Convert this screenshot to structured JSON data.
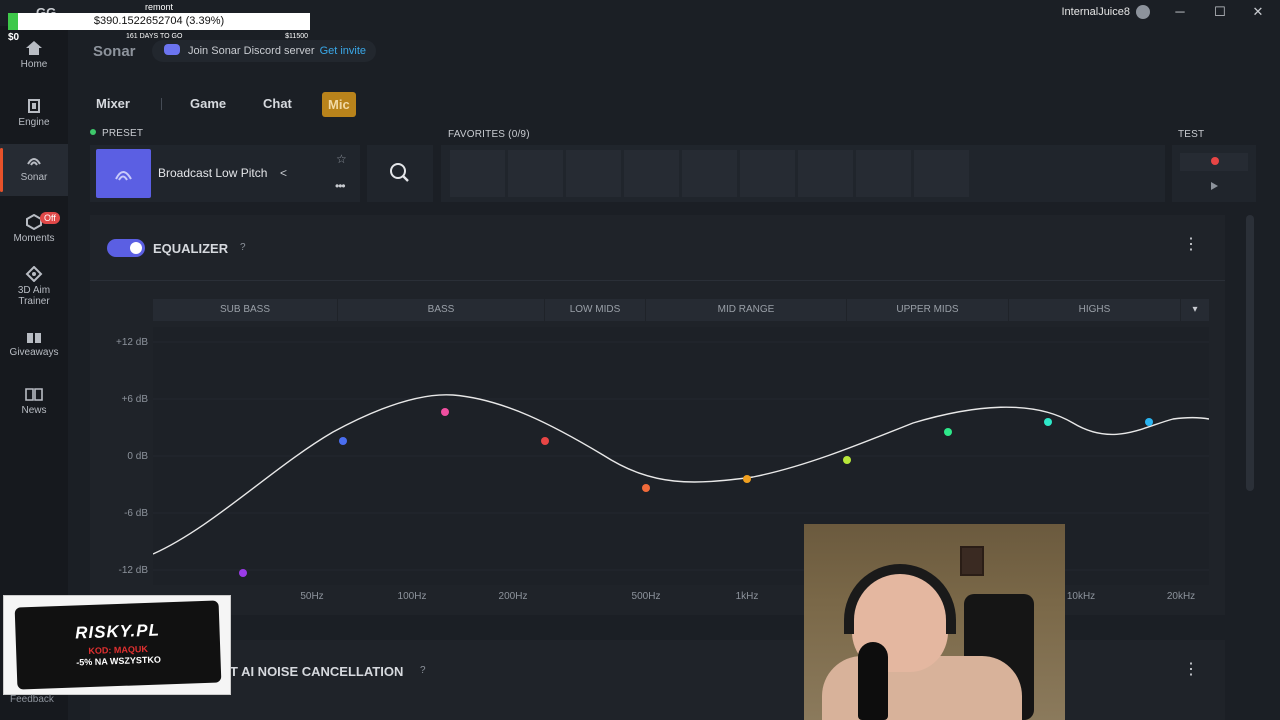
{
  "window": {
    "user": "InternalJuice8",
    "minimize": "─",
    "maximize": "☐",
    "close": "✕"
  },
  "overlay": {
    "donor": "remont",
    "amount": "$390.1522652704 (3.39%)",
    "start": "$0",
    "days": "161 DAYS TO GO",
    "goal": "$11500",
    "progress_fraction": 0.0339,
    "app_logo": "GG"
  },
  "sidebar": {
    "items": [
      {
        "label": "Home",
        "icon": "home-icon"
      },
      {
        "label": "Engine",
        "icon": "chip-icon"
      },
      {
        "label": "Sonar",
        "icon": "sonar-icon"
      },
      {
        "label": "Moments",
        "icon": "moments-icon",
        "badge": "Off"
      },
      {
        "label": "3D Aim Trainer",
        "icon": "aim-icon"
      },
      {
        "label": "Giveaways",
        "icon": "gift-icon"
      },
      {
        "label": "News",
        "icon": "news-icon"
      }
    ],
    "feedback": "Feedback"
  },
  "header": {
    "title": "Sonar",
    "discord_text": "Join Sonar Discord server",
    "discord_link": "Get invite"
  },
  "tabs": [
    "Mixer",
    "Game",
    "Chat",
    "Mic"
  ],
  "active_tab": "Mic",
  "preset": {
    "label": "PRESET",
    "name": "Broadcast Low Pitch"
  },
  "favorites": {
    "label": "FAVORITES (0/9)"
  },
  "test": {
    "label": "TEST"
  },
  "equalizer": {
    "title": "EQUALIZER",
    "help": "?",
    "enabled": true,
    "bands": [
      "SUB BASS",
      "BASS",
      "LOW MIDS",
      "MID RANGE",
      "UPPER MIDS",
      "HIGHS"
    ],
    "y_labels": [
      "+12 dB",
      "+6 dB",
      "0 dB",
      "-6 dB",
      "-12 dB"
    ],
    "x_labels": [
      "50Hz",
      "100Hz",
      "200Hz",
      "500Hz",
      "1kHz",
      "10kHz",
      "20kHz"
    ],
    "colors": {
      "accent": "#5b5fe3",
      "curve": "#e8e8e8",
      "points": [
        "#9b3be8",
        "#4a6ef0",
        "#ef4fa0",
        "#e84545",
        "#f06a3a",
        "#f0a020",
        "#b8e83a",
        "#2ee88a",
        "#2ee8c8",
        "#2ab4f0"
      ]
    }
  },
  "noise_cancel": {
    "title": "T AI NOISE CANCELLATION",
    "help": "?"
  },
  "promo": {
    "logo": "RISKY.PL",
    "code": "KOD: MAQUK",
    "discount": "-5% NA WSZYSTKO"
  }
}
